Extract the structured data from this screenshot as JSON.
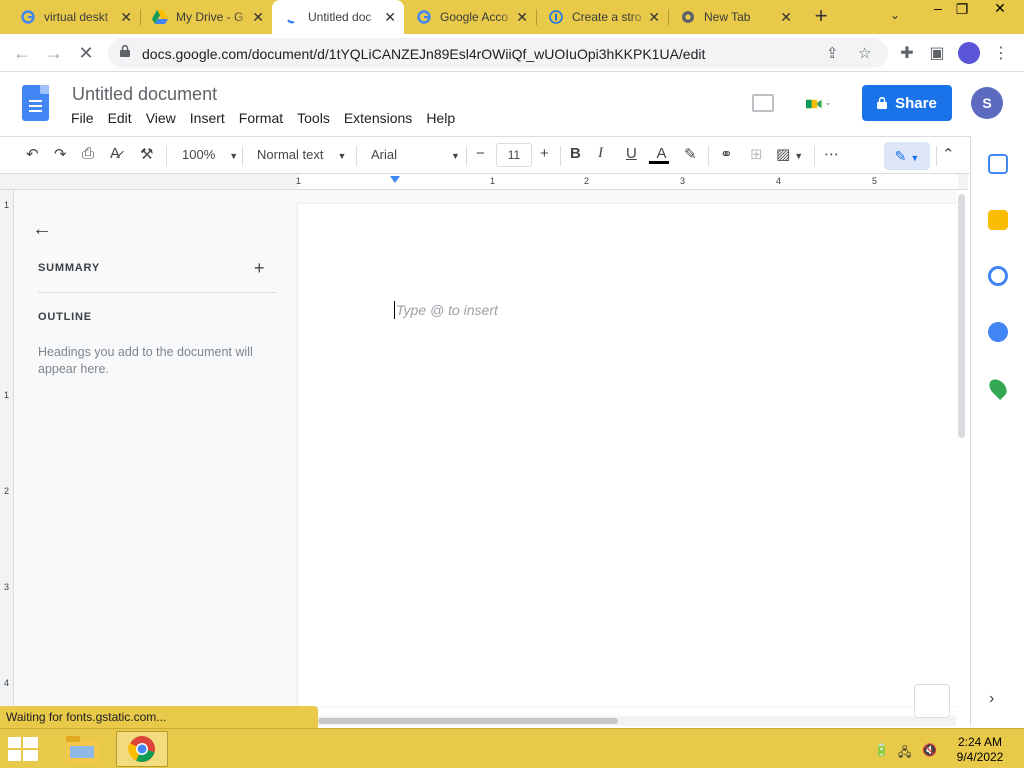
{
  "browser": {
    "tabs": [
      {
        "title": "virtual deskt",
        "favicon": "google-g-icon",
        "active": false
      },
      {
        "title": "My Drive - G",
        "favicon": "google-drive-icon",
        "active": false
      },
      {
        "title": "Untitled doc",
        "favicon": "loading-spinner-icon",
        "active": true
      },
      {
        "title": "Google Acco",
        "favicon": "google-g-icon",
        "active": false
      },
      {
        "title": "Create a stro",
        "favicon": "info-circle-icon",
        "active": false
      },
      {
        "title": "New Tab",
        "favicon": "chrome-icon",
        "active": false
      }
    ],
    "url": "docs.google.com/document/d/1tYQLiCANZEJn89Esl4rOWiiQf_wUOIuOpi3hKKPK1UA/edit",
    "window_controls": {
      "minimize": "–",
      "restore": "❐",
      "close": "✕"
    }
  },
  "docs": {
    "title": "Untitled document",
    "menu": [
      "File",
      "Edit",
      "View",
      "Insert",
      "Format",
      "Tools",
      "Extensions",
      "Help"
    ],
    "share_label": "Share",
    "avatar_initial": "S",
    "toolbar": {
      "zoom": "100%",
      "style": "Normal text",
      "font": "Arial",
      "font_size": "11"
    },
    "outline_panel": {
      "summary_label": "SUMMARY",
      "outline_label": "OUTLINE",
      "outline_hint": "Headings you add to the document will appear here."
    },
    "placeholder": "Type @ to insert",
    "ruler_h": [
      "1",
      "1",
      "2",
      "3",
      "4",
      "5"
    ],
    "ruler_v": [
      "1",
      "1",
      "2",
      "3",
      "4"
    ]
  },
  "status_text": "Waiting for fonts.gstatic.com...",
  "taskbar": {
    "time": "2:24 AM",
    "date": "9/4/2022"
  },
  "colors": {
    "theme_yellow": "#e8c94a",
    "share_blue": "#1a73e8",
    "docs_blue": "#4285f4",
    "avatar_purple": "#5c6bc0"
  }
}
